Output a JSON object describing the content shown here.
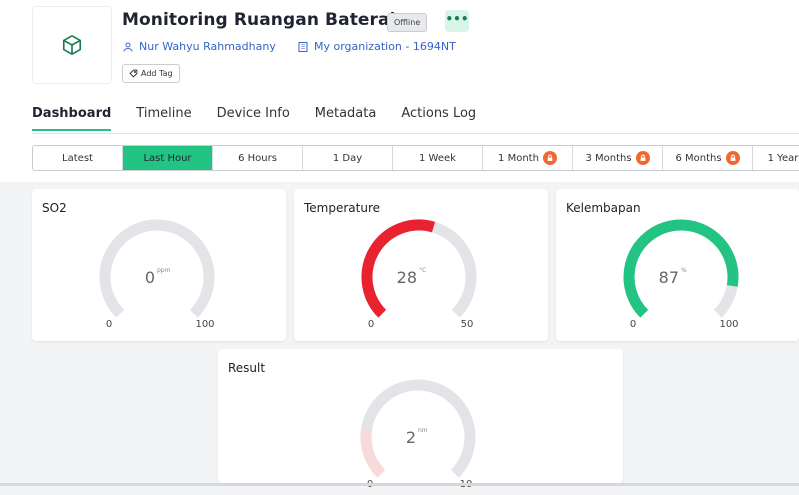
{
  "header": {
    "title": "Monitoring Ruangan Baterai",
    "status_badge": "Offline",
    "more_label": "•••",
    "owner": "Nur Wahyu Rahmadhany",
    "organization": "My organization - 1694NT",
    "add_tag": "Add Tag"
  },
  "tabs": [
    "Dashboard",
    "Timeline",
    "Device Info",
    "Metadata",
    "Actions Log"
  ],
  "time_ranges": [
    "Latest",
    "Last Hour",
    "6 Hours",
    "1 Day",
    "1 Week",
    "1 Month",
    "3 Months",
    "6 Months",
    "1 Year"
  ],
  "colors": {
    "accent": "#23c483",
    "red": "#e8232f",
    "green": "#23c483",
    "lock": "#f06a2f",
    "track": "#e2e4e8",
    "link": "#3763c7"
  },
  "widgets": [
    {
      "title": "SO2",
      "value": "0",
      "unit": "ppm",
      "min": "0",
      "max": "100",
      "fraction": 0.0,
      "color": "#e2e4e8"
    },
    {
      "title": "Temperature",
      "value": "28",
      "unit": "°C",
      "min": "0",
      "max": "50",
      "fraction": 0.56,
      "color": "#e8232f"
    },
    {
      "title": "Kelembapan",
      "value": "87",
      "unit": "%",
      "min": "0",
      "max": "100",
      "fraction": 0.87,
      "color": "#23c483"
    },
    {
      "title": "Result",
      "value": "2",
      "unit": "nm",
      "min": "0",
      "max": "10",
      "fraction": 0.2,
      "color": "#f9dada"
    }
  ]
}
